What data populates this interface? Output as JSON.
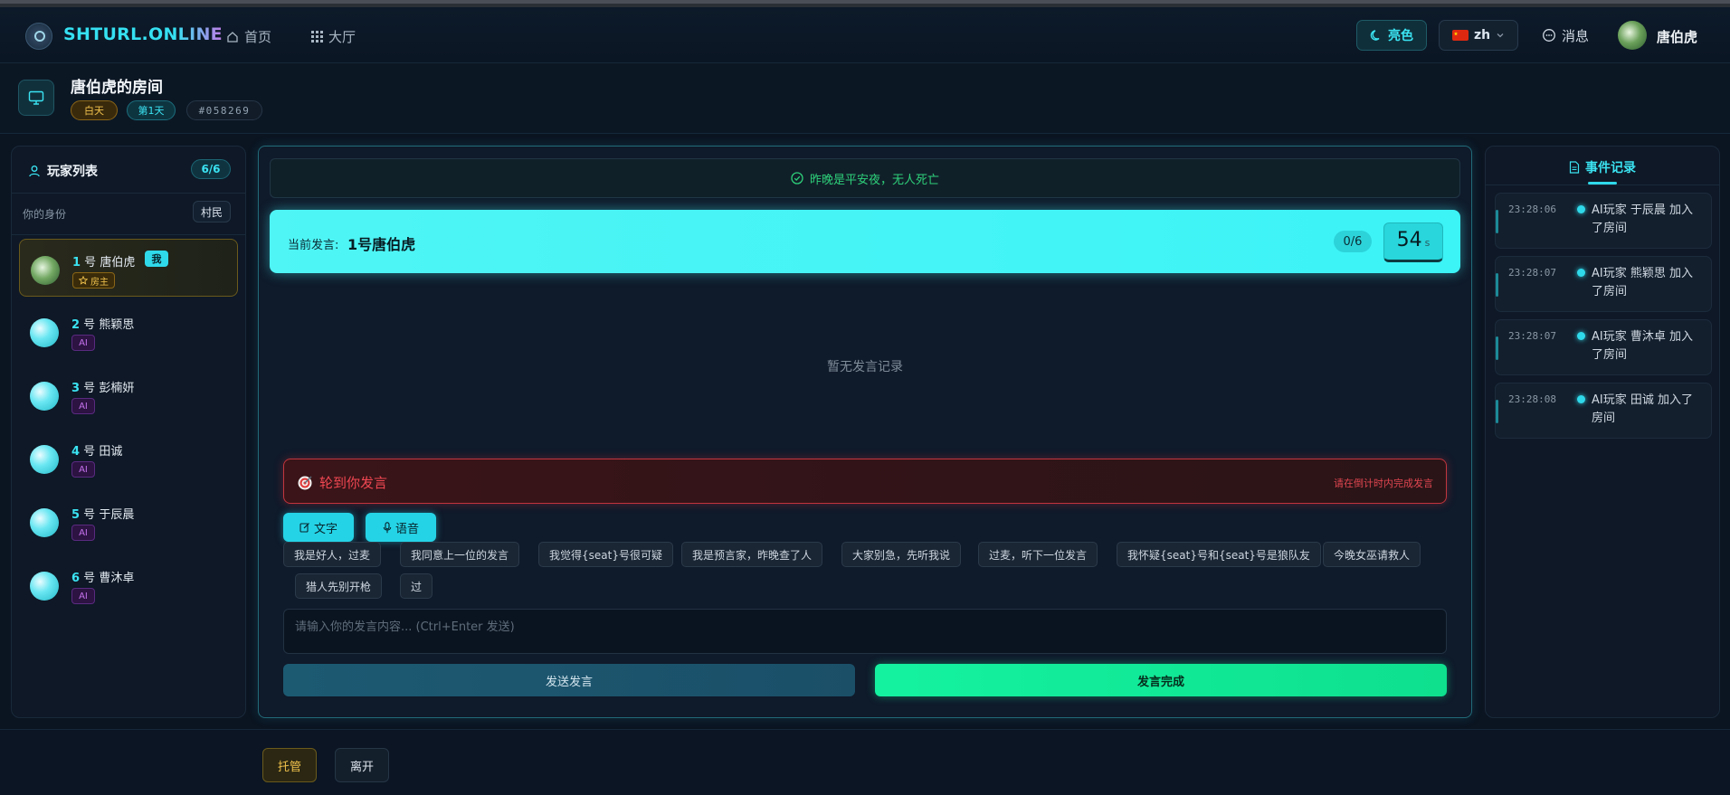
{
  "header": {
    "brand": "SHTURL.ONLINE",
    "nav": [
      {
        "label": "首页",
        "icon": "home-icon"
      },
      {
        "label": "大厅",
        "icon": "grid-icon"
      }
    ],
    "theme_label": "亮色",
    "lang_label": "zh",
    "messages_label": "消息",
    "user_name": "唐伯虎"
  },
  "room": {
    "title": "唐伯虎的房间",
    "phase": "白天",
    "day": "第1天",
    "room_id": "#058269"
  },
  "players_panel": {
    "title": "玩家列表",
    "count": "6/6",
    "identity_label": "你的身份",
    "identity_value": "村民",
    "players": [
      {
        "num": "1",
        "suffix": " 号 ",
        "name": "唐伯虎",
        "me_label": "我",
        "badge": "房主"
      },
      {
        "num": "2",
        "suffix": " 号 ",
        "name": "熊颖思",
        "badge": "AI"
      },
      {
        "num": "3",
        "suffix": " 号 ",
        "name": "彭楠妍",
        "badge": "AI"
      },
      {
        "num": "4",
        "suffix": " 号 ",
        "name": "田诚",
        "badge": "AI"
      },
      {
        "num": "5",
        "suffix": " 号 ",
        "name": "于辰晨",
        "badge": "AI"
      },
      {
        "num": "6",
        "suffix": " 号 ",
        "name": "曹沐卓",
        "badge": "AI"
      }
    ]
  },
  "center": {
    "notice": "昨晚是平安夜，无人死亡",
    "current_speaker_label": "当前发言:",
    "current_speaker": "1号唐伯虎",
    "speech_progress": "0/6",
    "timer_value": "54",
    "timer_unit": "s",
    "empty_text": "暂无发言记录",
    "turn_title": "轮到你发言",
    "turn_hint": "请在倒计时内完成发言",
    "mode_text": "文字",
    "mode_voice": "语音",
    "phrases": [
      "我是好人，过麦",
      "我同意上一位的发言",
      "我觉得{seat}号很可疑",
      "我是预言家，昨晚查了人",
      "大家别急，先听我说",
      "过麦，听下一位发言",
      "我怀疑{seat}号和{seat}号是狼队友",
      "今晚女巫请救人",
      "猎人先别开枪",
      "过"
    ],
    "input_placeholder": "请输入你的发言内容... (Ctrl+Enter 发送)",
    "send_label": "发送发言",
    "done_label": "发言完成"
  },
  "events_panel": {
    "tab_label": "事件记录",
    "events": [
      {
        "time": "23:28:06",
        "text": "AI玩家 于辰晨 加入了房间"
      },
      {
        "time": "23:28:07",
        "text": "AI玩家 熊颖思 加入了房间"
      },
      {
        "time": "23:28:07",
        "text": "AI玩家 曹沐卓 加入了房间"
      },
      {
        "time": "23:28:08",
        "text": "AI玩家 田诚 加入了房间"
      }
    ]
  },
  "bottom": {
    "auto_label": "托管",
    "leave_label": "离开"
  },
  "colors": {
    "accent_cyan": "#3be3f2",
    "success_green": "#14f2a0",
    "danger_red": "#f04752",
    "gold": "#f0c14c"
  }
}
